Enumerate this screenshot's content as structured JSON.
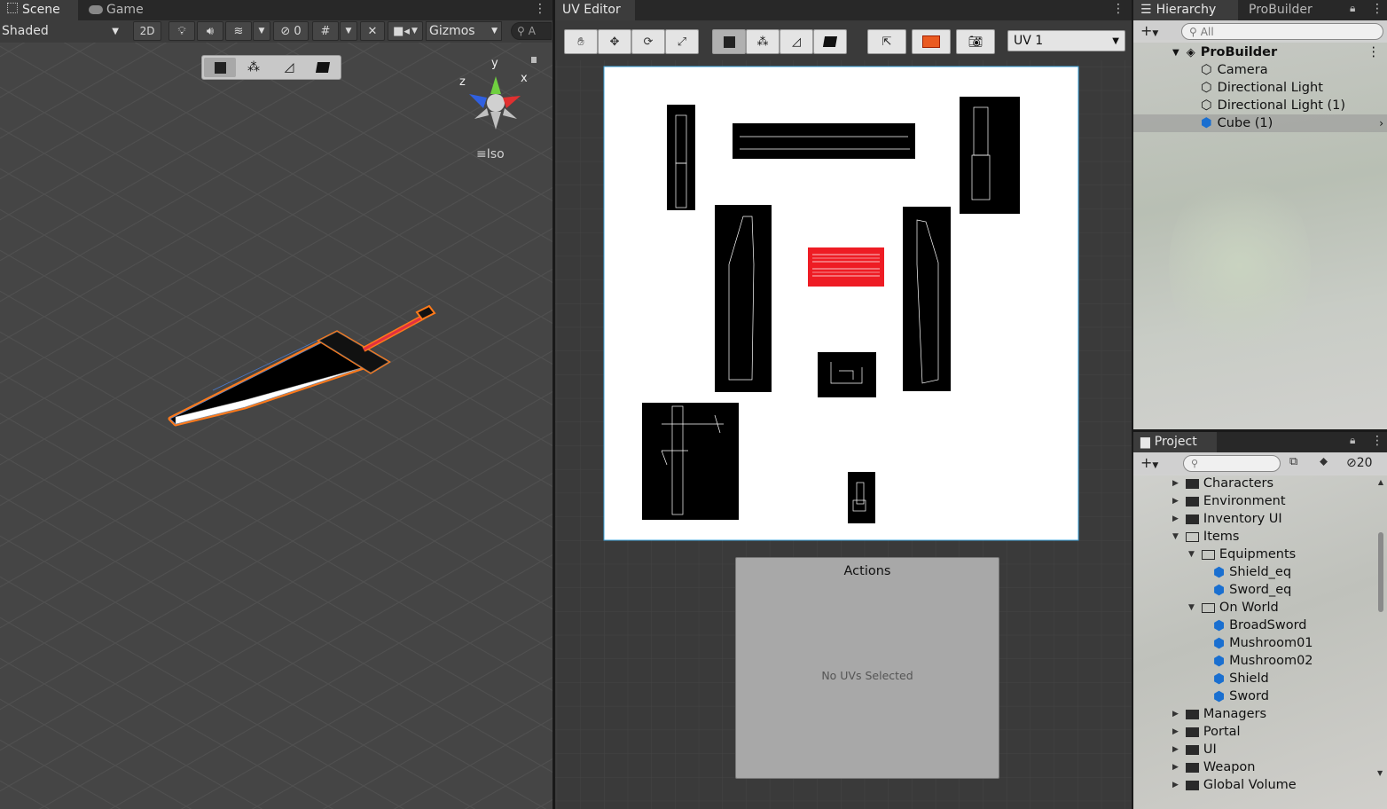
{
  "scene": {
    "tabs": [
      "Scene",
      "Game"
    ],
    "shading_mode": "Shaded",
    "toggle_2d": "2D",
    "hidden_count": "0",
    "gizmos_label": "Gizmos",
    "search_label": "A",
    "gizmo_axes": [
      "y",
      "x",
      "z"
    ],
    "projection_label": "Iso",
    "colors": {
      "selection_outline": "#ff7a1a",
      "background": "#444444"
    }
  },
  "uv_editor": {
    "tab_title": "UV Editor",
    "uv_channel": "UV 1",
    "actions_title": "Actions",
    "actions_status": "No UVs Selected",
    "colors": {
      "selected_island": "#ee1c24",
      "canvas": "#ffffff",
      "island": "#000000"
    }
  },
  "hierarchy": {
    "tabs": [
      "Hierarchy",
      "ProBuilder"
    ],
    "search_placeholder": "All",
    "scene_name": "ProBuilder",
    "items": [
      "Camera",
      "Directional Light",
      "Directional Light (1)",
      "Cube (1)"
    ],
    "selected_item": "Cube (1)"
  },
  "project": {
    "tab_title": "Project",
    "hidden_count": "20",
    "tree": [
      {
        "label": "Characters",
        "type": "folder",
        "depth": 0,
        "expanded": false
      },
      {
        "label": "Environment",
        "type": "folder",
        "depth": 0,
        "expanded": false
      },
      {
        "label": "Inventory UI",
        "type": "folder",
        "depth": 0,
        "expanded": false
      },
      {
        "label": "Items",
        "type": "folder",
        "depth": 0,
        "expanded": true
      },
      {
        "label": "Equipments",
        "type": "folder",
        "depth": 1,
        "expanded": true
      },
      {
        "label": "Shield_eq",
        "type": "prefab",
        "depth": 2
      },
      {
        "label": "Sword_eq",
        "type": "prefab",
        "depth": 2
      },
      {
        "label": "On World",
        "type": "folder",
        "depth": 1,
        "expanded": true
      },
      {
        "label": "BroadSword",
        "type": "prefab",
        "depth": 2
      },
      {
        "label": "Mushroom01",
        "type": "prefab",
        "depth": 2
      },
      {
        "label": "Mushroom02",
        "type": "prefab",
        "depth": 2
      },
      {
        "label": "Shield",
        "type": "prefab",
        "depth": 2
      },
      {
        "label": "Sword",
        "type": "prefab",
        "depth": 2
      },
      {
        "label": "Managers",
        "type": "folder",
        "depth": 0,
        "expanded": false
      },
      {
        "label": "Portal",
        "type": "folder",
        "depth": 0,
        "expanded": false
      },
      {
        "label": "UI",
        "type": "folder",
        "depth": 0,
        "expanded": false
      },
      {
        "label": "Weapon",
        "type": "folder",
        "depth": 0,
        "expanded": false
      },
      {
        "label": "Global Volume",
        "type": "folder",
        "depth": 0,
        "expanded": false
      }
    ]
  }
}
